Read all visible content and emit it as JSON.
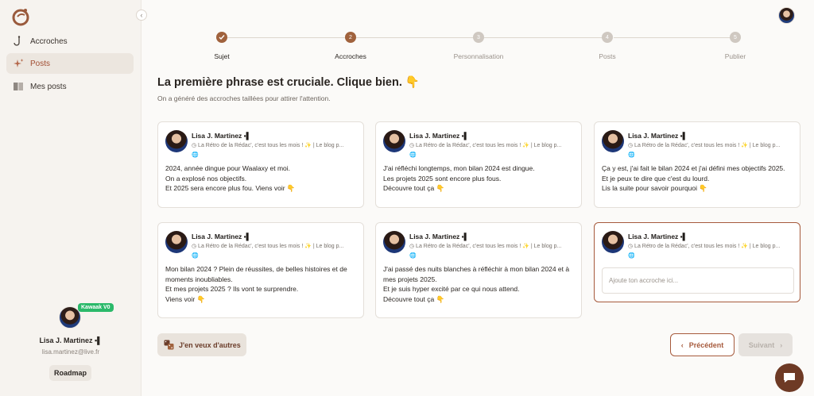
{
  "sidebar": {
    "items": [
      {
        "label": "Accroches",
        "icon": "hook-icon"
      },
      {
        "label": "Posts",
        "icon": "sparkle-icon"
      },
      {
        "label": "Mes posts",
        "icon": "book-icon"
      }
    ],
    "profile": {
      "badge": "Kawaak V0",
      "name": "Lisa J. Martinez ▪▌",
      "email": "lisa.martinez@live.fr",
      "roadmap_label": "Roadmap"
    }
  },
  "stepper": {
    "steps": [
      {
        "num": "1",
        "label": "Sujet",
        "state": "done"
      },
      {
        "num": "2",
        "label": "Accroches",
        "state": "current"
      },
      {
        "num": "3",
        "label": "Personnalisation",
        "state": "todo"
      },
      {
        "num": "4",
        "label": "Posts",
        "state": "todo"
      },
      {
        "num": "5",
        "label": "Publier",
        "state": "todo"
      }
    ]
  },
  "main": {
    "title": "La première phrase est cruciale. Clique bien. 👇",
    "subtitle": "On a généré des accroches taillées pour attirer l'attention."
  },
  "card_common": {
    "author": "Lisa J. Martinez ▪▌",
    "meta": "◷ La Rétro de la Rédac', c'est tous les mois ! ✨ | Le blog p...",
    "globe": "🌐"
  },
  "cards": [
    {
      "lines": [
        "2024, année dingue pour Waalaxy et moi.",
        "On a explosé nos objectifs.",
        "Et 2025 sera encore plus fou. Viens voir 👇"
      ]
    },
    {
      "lines": [
        "J'ai réfléchi longtemps, mon bilan 2024 est dingue.",
        "Les projets 2025 sont encore plus fous.",
        "Découvre tout ça 👇"
      ]
    },
    {
      "lines": [
        "Ça y est, j'ai fait le bilan 2024 et j'ai défini mes objectifs 2025.",
        "Et je peux te dire que c'est du lourd.",
        "Lis la suite pour savoir pourquoi 👇"
      ]
    },
    {
      "lines": [
        "Mon bilan 2024 ? Plein de réussites, de belles histoires et de",
        "moments inoubliables.",
        "Et mes projets 2025 ? Ils vont te surprendre.",
        "Viens voir 👇"
      ]
    },
    {
      "lines": [
        "J'ai passé des nuits blanches à réfléchir à mon bilan 2024 et à",
        "mes projets 2025.",
        "Et je suis hyper excité par ce qui nous attend.",
        "Découvre tout ça 👇"
      ]
    }
  ],
  "custom_card": {
    "placeholder": "Ajoute ton accroche ici..."
  },
  "actions": {
    "more_label": "J'en veux d'autres",
    "prev_label": "Précédent",
    "next_label": "Suivant"
  },
  "colors": {
    "accent": "#a65a3c",
    "badge": "#2bb96a"
  }
}
